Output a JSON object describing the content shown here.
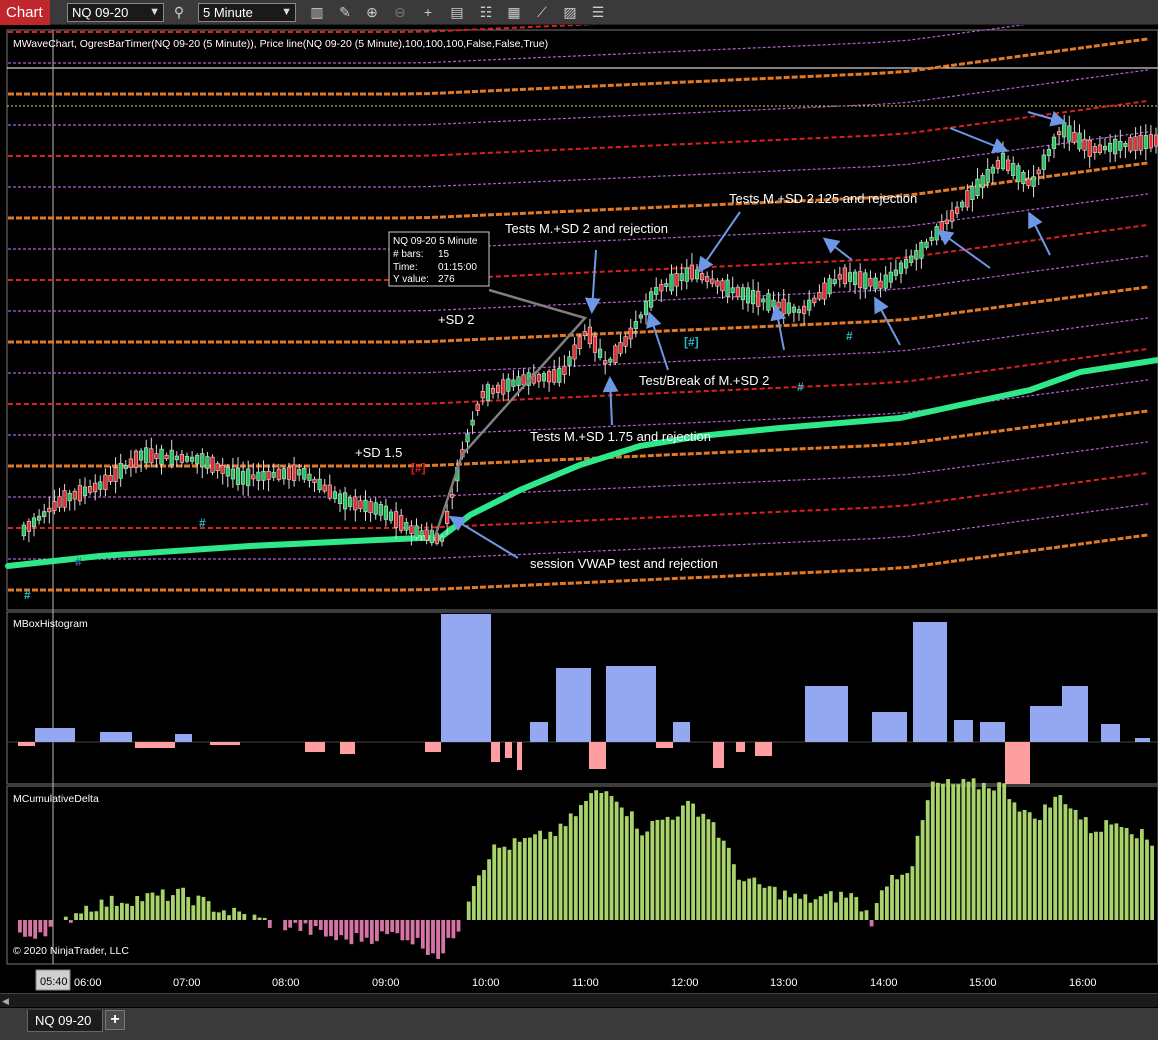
{
  "toolbar": {
    "chart_tab": "Chart",
    "instrument": "NQ 09-20",
    "interval": "5 Minute"
  },
  "panels": {
    "price_title": "MWaveChart, OgresBarTimer(NQ 09-20 (5 Minute)), Price line(NQ 09-20 (5 Minute),100,100,100,False,False,True)",
    "histogram_title": "MBoxHistogram",
    "delta_title": "MCumulativeDelta",
    "copyright": "© 2020 NinjaTrader, LLC"
  },
  "tooltip": {
    "title": "NQ 09-20 5 Minute",
    "rows": [
      {
        "label": "# bars:",
        "value": "15"
      },
      {
        "label": "Time:",
        "value": "01:15:00"
      },
      {
        "label": "Y value:",
        "value": "276"
      }
    ]
  },
  "annotations": {
    "sd2_label": "+SD 2",
    "sd15_label": "+SD 1.5",
    "tests_sd2": "Tests M.+SD 2 and rejection",
    "tests_sd2125": "Tests M.+SD 2.125 and rejection",
    "test_break": "Test/Break of M.+SD 2",
    "tests_sd175": "Tests M.+SD 1.75 and rejection",
    "vwap_test": "session VWAP test and rejection",
    "hash": "#",
    "bracket_hash": "[#]"
  },
  "time_axis": {
    "cursor_time": "05:40",
    "labels": [
      "06:00",
      "07:00",
      "08:00",
      "09:00",
      "10:00",
      "11:00",
      "12:00",
      "13:00",
      "14:00",
      "15:00",
      "16:00"
    ]
  },
  "bottom": {
    "instrument_tab": "NQ 09-20",
    "add_tab": "+"
  },
  "colors": {
    "up_candle": "#22c55e",
    "down_candle": "#e0302f",
    "vwap": "#2ee88a",
    "hist_up": "#93a8f0",
    "hist_down": "#ff9ea0",
    "delta_up": "#a8d26a",
    "delta_down": "#d774a6",
    "band_orange": "#e07a2a",
    "band_red": "#d9211f",
    "band_violet": "#b05fd0",
    "chart_tab": "#c0272d"
  }
}
